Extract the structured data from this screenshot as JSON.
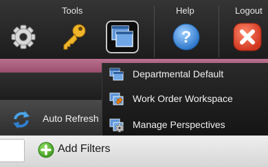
{
  "toolbar": {
    "groups": [
      {
        "label": "Tools"
      },
      {
        "label": "Help"
      },
      {
        "label": "Logout"
      }
    ],
    "buttons": [
      {
        "icon": "gear-icon"
      },
      {
        "icon": "key-icon"
      },
      {
        "icon": "windows-icon",
        "state": "active"
      },
      {
        "icon": "help-icon"
      },
      {
        "icon": "logout-icon"
      }
    ]
  },
  "perspectives_menu": {
    "items": [
      {
        "label": "Departmental Default",
        "icon": "layout-icon"
      },
      {
        "label": "Work Order Workspace",
        "icon": "workorder-icon"
      },
      {
        "label": "Manage Perspectives",
        "icon": "manage-icon"
      }
    ]
  },
  "refresh": {
    "label": "Auto Refresh"
  },
  "filters": {
    "add_label": "Add Filters",
    "input_value": ""
  },
  "colors": {
    "accent": "#a95b7c",
    "help_blue": "#3a8fd6",
    "logout_red": "#d9361e",
    "add_green": "#4fae2a"
  }
}
